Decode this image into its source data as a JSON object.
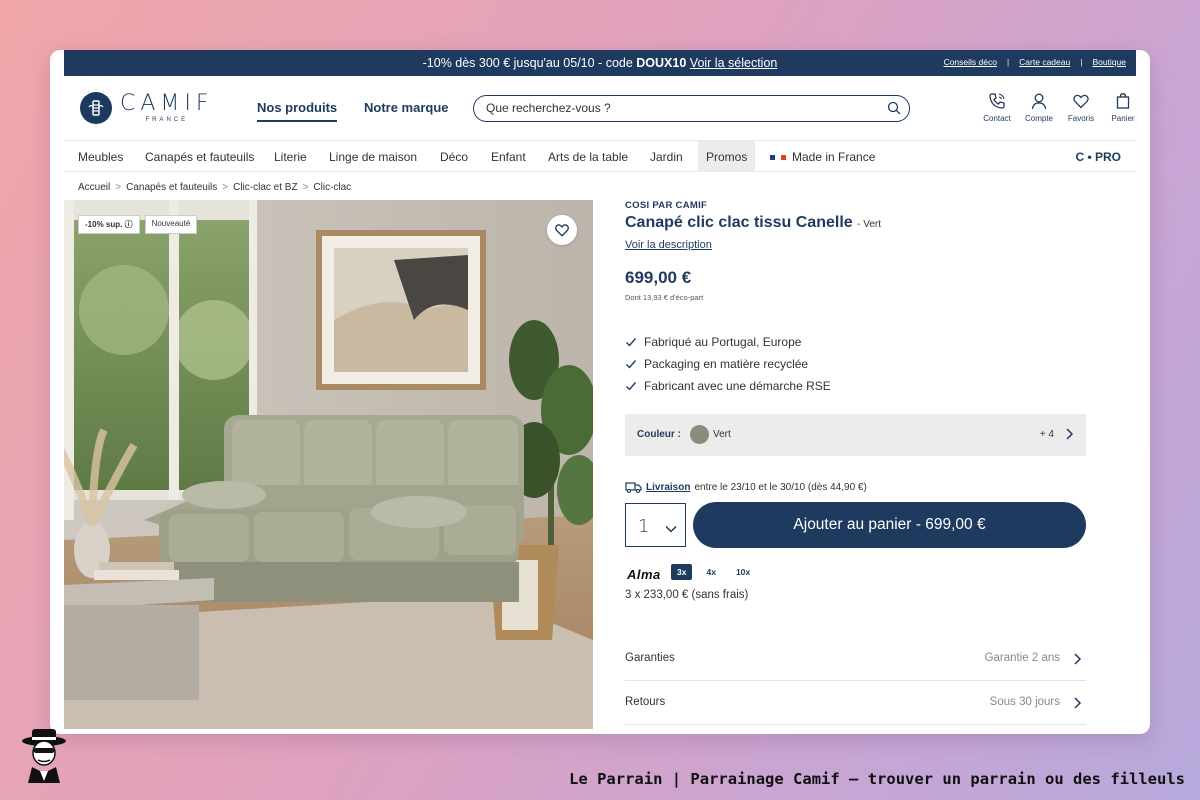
{
  "promo_bar": {
    "text_before": "-10% dès 300 € jusqu'au 05/10 - code ",
    "code": "DOUX10",
    "link": "Voir la sélection",
    "links": [
      "Conseils déco",
      "Carte cadeau",
      "Boutique"
    ],
    "separator": "|"
  },
  "header": {
    "logo_word": "CAMIF",
    "logo_sub": "FRANCE",
    "nav": [
      "Nos produits",
      "Notre marque"
    ],
    "search_placeholder": "Que recherchez-vous ?",
    "icons": [
      {
        "name": "phone-icon",
        "label": "Contact"
      },
      {
        "name": "user-icon",
        "label": "Compte"
      },
      {
        "name": "heart-icon",
        "label": "Favoris"
      },
      {
        "name": "bag-icon",
        "label": "Panier"
      }
    ]
  },
  "categories": [
    "Meubles",
    "Canapés et fauteuils",
    "Literie",
    "Linge de maison",
    "Déco",
    "Enfant",
    "Arts de la table",
    "Jardin",
    "Promos"
  ],
  "made_in_france": "Made in France",
  "pro_label": "C • PRO",
  "breadcrumb": [
    "Accueil",
    "Canapés et fauteuils",
    "Clic-clac et BZ",
    "Clic-clac"
  ],
  "breadcrumb_sep": ">",
  "image": {
    "badges": [
      "-10% sup.",
      "Nouveauté"
    ]
  },
  "product": {
    "brand": "COSI PAR CAMIF",
    "title": "Canapé clic clac tissu Canelle",
    "variant": "- Vert",
    "description_link": "Voir la description",
    "price": "699,00 €",
    "eco_part": "Dont 13,93 € d'éco-part",
    "features": [
      "Fabriqué au Portugal, Europe",
      "Packaging en matière recyclée",
      "Fabricant avec une démarche RSE"
    ],
    "color_label": "Couleur :",
    "color_value": "Vert",
    "color_swatch": "#8a8c7c",
    "color_more": "+ 4",
    "delivery_link": "Livraison",
    "delivery_text": " entre le 23/10 et le 30/10 (dès 44,90 €)",
    "quantity": "1",
    "add_to_cart": "Ajouter au panier - 699,00 €",
    "alma": "Alma",
    "payment_options": [
      "3x",
      "4x",
      "10x"
    ],
    "installment": "3 x 233,00 € (sans frais)",
    "accordions": [
      {
        "label": "Garanties",
        "value": "Garantie 2 ans"
      },
      {
        "label": "Retours",
        "value": "Sous 30 jours"
      }
    ]
  },
  "footer": {
    "text": "Le Parrain | Parrainage Camif — trouver un parrain ou des filleuls"
  },
  "colors": {
    "brand_navy": "#1e3a5f",
    "promo_bg": "#1e3a5f"
  }
}
